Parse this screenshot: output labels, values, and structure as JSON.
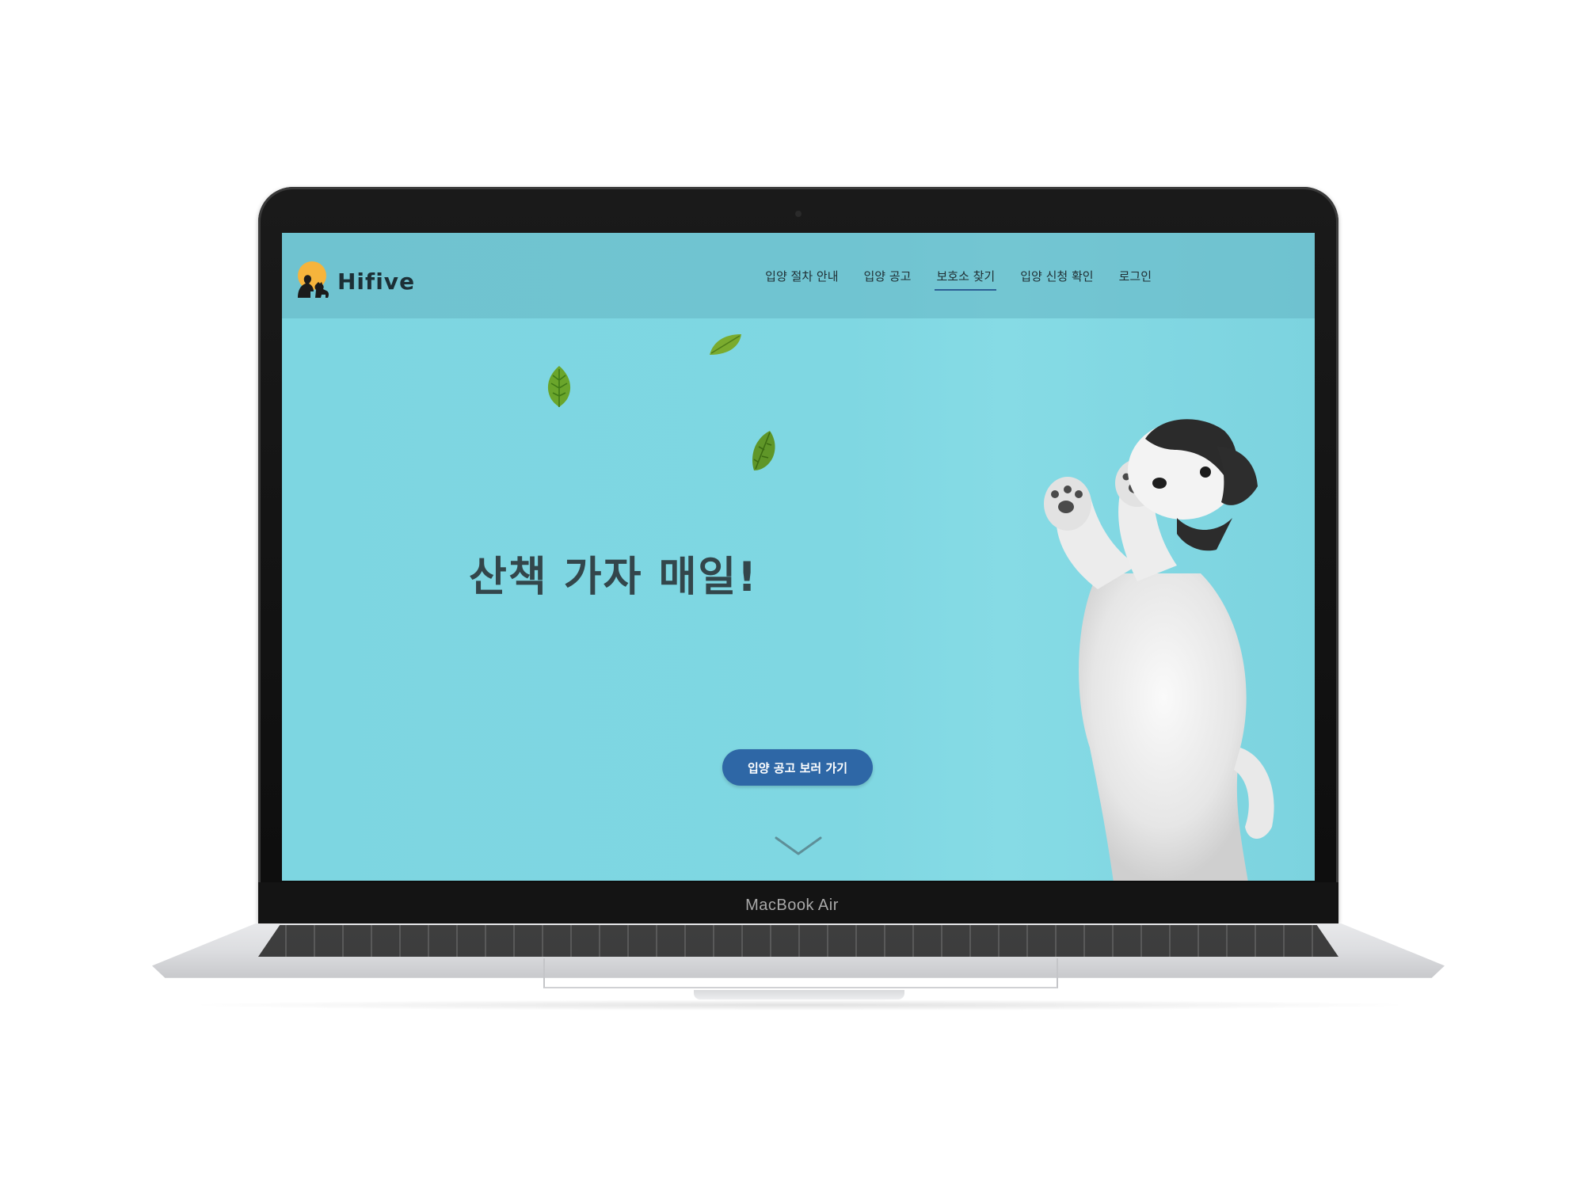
{
  "device": {
    "label": "MacBook Air"
  },
  "site": {
    "logo_text": "Hifive",
    "nav": [
      {
        "label": "입양 절차 안내",
        "active": false
      },
      {
        "label": "입양 공고",
        "active": false
      },
      {
        "label": "보호소 찾기",
        "active": true
      },
      {
        "label": "입양 신청 확인",
        "active": false
      },
      {
        "label": "로그인",
        "active": false
      }
    ]
  },
  "hero": {
    "title": "산책 가자 매일!",
    "cta_label": "입양 공고 보러 가기"
  },
  "colors": {
    "background": "#7fd7e2",
    "header": "#6cb9c6",
    "cta": "#2e67a6",
    "title": "#33464b",
    "nav_underline": "#2d5f95",
    "logo_sun": "#f6b43c",
    "leaf": "#6aa52b"
  },
  "icons": {
    "logo": "dog-and-person-silhouette-icon",
    "scroll": "chevron-down-icon",
    "leaf": "leaf-icon"
  }
}
